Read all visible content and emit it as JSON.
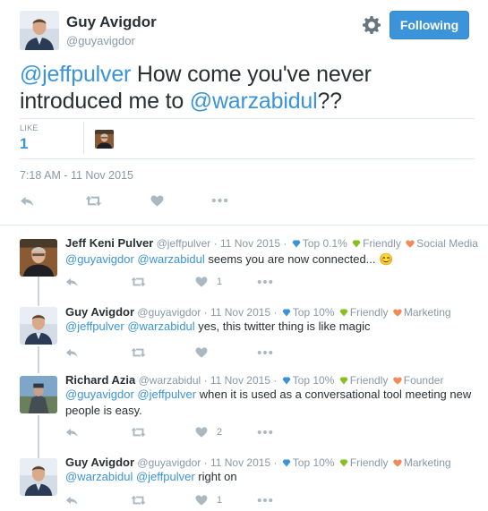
{
  "tweet": {
    "author_name": "Guy Avigdor",
    "author_handle": "@guyavigdor",
    "follow_label": "Following",
    "text_parts": [
      {
        "text": "@jeffpulver",
        "mention": true
      },
      {
        "text": " How come you've never introduced me to ",
        "mention": false
      },
      {
        "text": "@warzabidul",
        "mention": true
      },
      {
        "text": "??",
        "mention": false
      }
    ],
    "likes_label": "LIKE",
    "likes_count": "1",
    "timestamp": "7:18 AM - 11 Nov 2015"
  },
  "colors": {
    "mention": "#3b94d9",
    "muted": "#8899a6",
    "top_badge": "#3b94d9",
    "friendly_badge": "#84c11e",
    "role_badge": "#f08c5a",
    "thread_line": "#ccd6dd"
  },
  "icons": [
    "gear-icon",
    "reply-icon",
    "retweet-icon",
    "heart-icon",
    "more-icon",
    "diamond-icon",
    "heart-badge-icon"
  ],
  "replies": [
    {
      "name": "Jeff Keni Pulver",
      "handle": "@jeffpulver",
      "date": "· 11 Nov 2015 ·",
      "top": "Top 0.1%",
      "friendly": "Friendly",
      "role": "Social Media",
      "mentions": "@guyavigdor @warzabidul",
      "text": " seems you are now connected... ",
      "emoji": "😊",
      "likes": "1"
    },
    {
      "name": "Guy Avigdor",
      "handle": "@guyavigdor",
      "date": "· 11 Nov 2015 ·",
      "top": "Top 10%",
      "friendly": "Friendly",
      "role": "Marketing",
      "mentions": "@jeffpulver @warzabidul",
      "text": " yes, this twitter thing is like magic"
    },
    {
      "name": "Richard Azia",
      "handle": "@warzabidul",
      "date": "· 11 Nov 2015 ·",
      "top": "Top 10%",
      "friendly": "Friendly",
      "role": "Founder",
      "mentions": "@guyavigdor @jeffpulver",
      "text": " when it is used as a conversational tool meeting new people is easy.",
      "likes": "2"
    },
    {
      "name": "Guy Avigdor",
      "handle": "@guyavigdor",
      "date": "· 11 Nov 2015 ·",
      "top": "Top 10%",
      "friendly": "Friendly",
      "role": "Marketing",
      "mentions": "@warzabidul @jeffpulver",
      "text": " right on",
      "likes": "1"
    }
  ]
}
